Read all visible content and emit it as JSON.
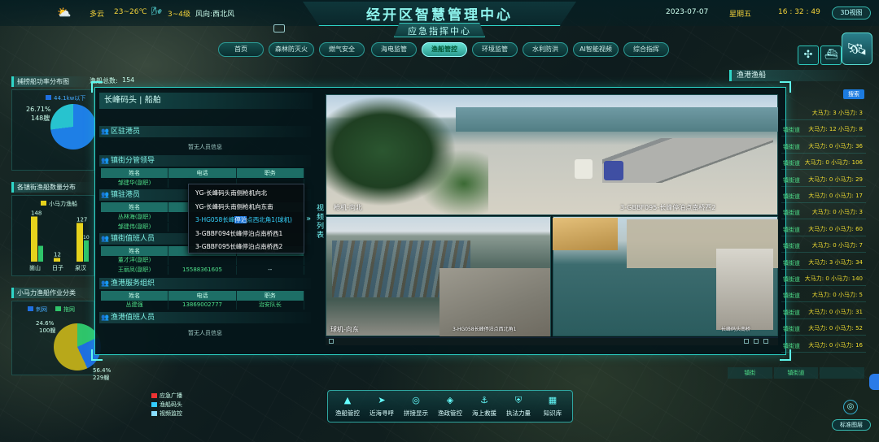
{
  "header": {
    "weather": "多云",
    "temp": "23~26℃",
    "wind_level": "3~4级",
    "wind_dir_label": "风向:",
    "wind_dir": "西北风",
    "title": "经开区智慧管理中心",
    "subtitle": "应急指挥中心",
    "date": "2023-07-07",
    "weekday": "星期五",
    "time": "16 : 32 : 49",
    "btn_3d": "3D视图"
  },
  "nav_tabs": [
    "首页",
    "森林防灭火",
    "燃气安全",
    "海电监管",
    "渔船管控",
    "环境监管",
    "水利防洪",
    "AI智能视频",
    "综合指挥"
  ],
  "left": {
    "panel1_title": "捕捞船功率分布图",
    "fishing_total_label": "渔船总数:",
    "fishing_total": "154",
    "legend_a": "44.1kw以下",
    "pct": "26.71%",
    "count": "148艘",
    "panel2_title": "各镇街渔船数量分布",
    "legend_b": "小马力渔船",
    "bars": [
      {
        "label": "崮山",
        "top": "148",
        "mid": "",
        "value": 148
      },
      {
        "label": "日子",
        "top": "12",
        "mid": "",
        "value": 12
      },
      {
        "label": "泉汉",
        "top": "127",
        "mid": "10",
        "value": 127
      }
    ],
    "panel3_title": "小马力渔船作业分类",
    "legend_c1": "刺网",
    "legend_c2": "拖网",
    "pct2": "24.6%",
    "count2": "100艘",
    "pct3": "56.4%",
    "count3": "229艘"
  },
  "modal": {
    "title": "长峰码头 | 船舶",
    "sec1": "区驻港员",
    "noinfo1": "暂无人员信息",
    "sec2": "镇街分管领导",
    "cols": [
      "姓名",
      "电话",
      "职务"
    ],
    "sec2_rows": [
      [
        "邹建华(副职)",
        "",
        ""
      ]
    ],
    "sec3": "镇驻港员",
    "sec3_rows": [
      [
        "丛林海(副职)",
        "",
        ""
      ],
      [
        "邹建伟(副职)",
        "",
        ""
      ]
    ],
    "sec4": "镇街值班人员",
    "sec4_rows": [
      [
        "董才洋(副职)",
        "",
        ""
      ],
      [
        "王丽凤(副职)",
        "15588361605",
        "--"
      ]
    ],
    "sec5": "渔港服务组织",
    "sec5_rows": [
      [
        "丛建强",
        "13869002777",
        "治安队长"
      ]
    ],
    "sec6": "渔港值班人员",
    "noinfo6": "暂无人员信息",
    "side_tab": "视频列表",
    "dropdown": [
      "YG-长峰码头南侧枪机向北",
      "YG-长峰码头南侧枪机向东南",
      "3-HG058长峰停泊点西北角1(球机)",
      "3-GBBF094长峰停泊点南桥西1",
      "3-GBBF095长峰停泊点南桥西2"
    ],
    "dropdown_hl": "停泊",
    "cam_main_left": "枪机-向北",
    "cam_main_right": "3-GBBF095-长峰停泊点南桥西2",
    "cam_bl_left": "球机-向东",
    "cam_bl_right": "3-HG058长峰停泊点西北角1",
    "cam_br_right": "长峰码头南桥"
  },
  "right": {
    "title": "渔港渔船",
    "search": "搜索",
    "rows": [
      {
        "label": "",
        "text": "大马力: 3  小马力: 3"
      },
      {
        "label": "镇街道",
        "text": "大马力: 12  小马力: 8"
      },
      {
        "label": "镇街道",
        "text": "大马力: 0  小马力: 36"
      },
      {
        "label": "镇街道",
        "text": "大马力: 0  小马力: 106"
      },
      {
        "label": "镇街道",
        "text": "大马力: 0  小马力: 29"
      },
      {
        "label": "镇街道",
        "text": "大马力: 0  小马力: 17"
      },
      {
        "label": "镇街道",
        "text": "大马力: 0  小马力: 3"
      },
      {
        "label": "镇街道",
        "text": "大马力: 0  小马力: 60"
      },
      {
        "label": "镇街道",
        "text": "大马力: 0  小马力: 7"
      },
      {
        "label": "镇街道",
        "text": "大马力: 3  小马力: 34"
      },
      {
        "label": "镇街道",
        "text": "大马力: 0  小马力: 140"
      },
      {
        "label": "镇街道",
        "text": "大马力: 0  小马力: 5"
      },
      {
        "label": "镇街道",
        "text": "大马力: 0  小马力: 31"
      },
      {
        "label": "镇街道",
        "text": "大马力: 0  小马力: 52"
      },
      {
        "label": "镇街道",
        "text": "大马力: 0  小马力: 16"
      }
    ],
    "bottom_a": "镇街",
    "bottom_b": "镇街道",
    "std_btn": "标准图层"
  },
  "bottom_nav": [
    {
      "icon": "▲",
      "label": "渔船管控"
    },
    {
      "icon": "➤",
      "label": "近海寻呼"
    },
    {
      "icon": "◎",
      "label": "拼接显示"
    },
    {
      "icon": "◈",
      "label": "渔政管控"
    },
    {
      "icon": "⚓",
      "label": "海上救援"
    },
    {
      "icon": "⛨",
      "label": "执法力量"
    },
    {
      "icon": "▦",
      "label": "知识库"
    }
  ],
  "map_legend": [
    "应急广播",
    "渔船码头",
    "视频监控"
  ]
}
